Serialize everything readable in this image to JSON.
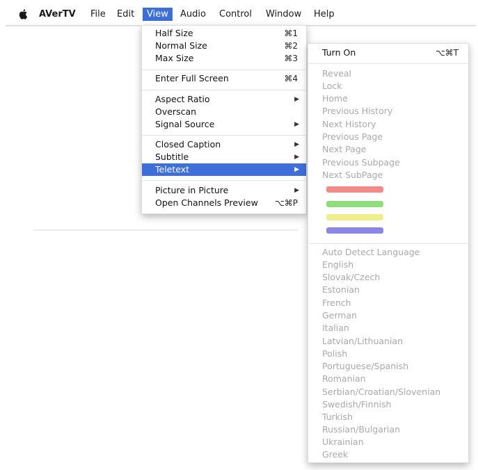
{
  "menubar": {
    "app_name": "AVerTV",
    "items": [
      "File",
      "Edit",
      "View",
      "Audio",
      "Control",
      "Window",
      "Help"
    ]
  },
  "view_menu": {
    "items": [
      {
        "label": "Half Size",
        "shortcut": "⌘1"
      },
      {
        "label": "Normal Size",
        "shortcut": "⌘2"
      },
      {
        "label": "Max Size",
        "shortcut": "⌘3"
      },
      {
        "label": "Enter Full Screen",
        "shortcut": "⌘4"
      },
      {
        "label": "Aspect Ratio",
        "submenu": true
      },
      {
        "label": "Overscan"
      },
      {
        "label": "Signal Source",
        "submenu": true
      },
      {
        "label": "Closed Caption",
        "submenu": true
      },
      {
        "label": "Subtitle",
        "submenu": true
      },
      {
        "label": "Teletext",
        "submenu": true,
        "highlighted": true
      },
      {
        "label": "Picture in Picture",
        "submenu": true
      },
      {
        "label": "Open Channels Preview",
        "shortcut": "⌥⌘P"
      }
    ]
  },
  "teletext_menu": {
    "turn_on": {
      "label": "Turn On",
      "shortcut": "⌥⌘T"
    },
    "navigation": [
      "Reveal",
      "Lock",
      "Home",
      "Previous History",
      "Next History",
      "Previous Page",
      "Next Page",
      "Previous Subpage",
      "Next SubPage"
    ],
    "color_keys": [
      {
        "name": "red-key",
        "color": "#f28a8a"
      },
      {
        "name": "green-key",
        "color": "#8fdc7a"
      },
      {
        "name": "yellow-key",
        "color": "#eeee8a"
      },
      {
        "name": "blue-key",
        "color": "#8c86e6"
      }
    ],
    "languages": [
      "Auto Detect Language",
      "English",
      "Slovak/Czech",
      "Estonian",
      "French",
      "German",
      "Italian",
      "Latvian/Lithuanian",
      "Polish",
      "Portuguese/Spanish",
      "Romanian",
      "Serbian/Croatian/Slovenian",
      "Swedish/Finnish",
      "Turkish",
      "Russian/Bulgarian",
      "Ukrainian",
      "Greek"
    ]
  },
  "colors": {
    "highlight": "#3d6fd8",
    "disabled_text": "#a9a9a9"
  }
}
